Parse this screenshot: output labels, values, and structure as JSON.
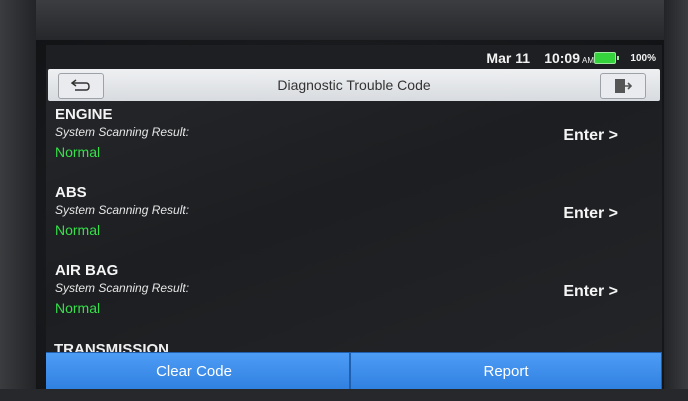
{
  "status_bar": {
    "date": "Mar 11",
    "time": "10:09",
    "ampm": "AM",
    "battery": "100%"
  },
  "header": {
    "title": "Diagnostic Trouble Code",
    "back_icon": "back-arrow-icon",
    "exit_icon": "exit-door-icon"
  },
  "systems": [
    {
      "name": "ENGINE",
      "label": "System Scanning Result:",
      "status": "Normal",
      "action": "Enter >"
    },
    {
      "name": "ABS",
      "label": "System Scanning Result:",
      "status": "Normal",
      "action": "Enter >"
    },
    {
      "name": "AIR BAG",
      "label": "System Scanning Result:",
      "status": "Normal",
      "action": "Enter >"
    },
    {
      "name": "TRANSMISSION"
    }
  ],
  "footer": {
    "clear_code": "Clear Code",
    "report": "Report"
  },
  "colors": {
    "status_normal": "#37e04a",
    "button_blue": "#3c8cec",
    "titlebar": "#e4e6e9"
  }
}
